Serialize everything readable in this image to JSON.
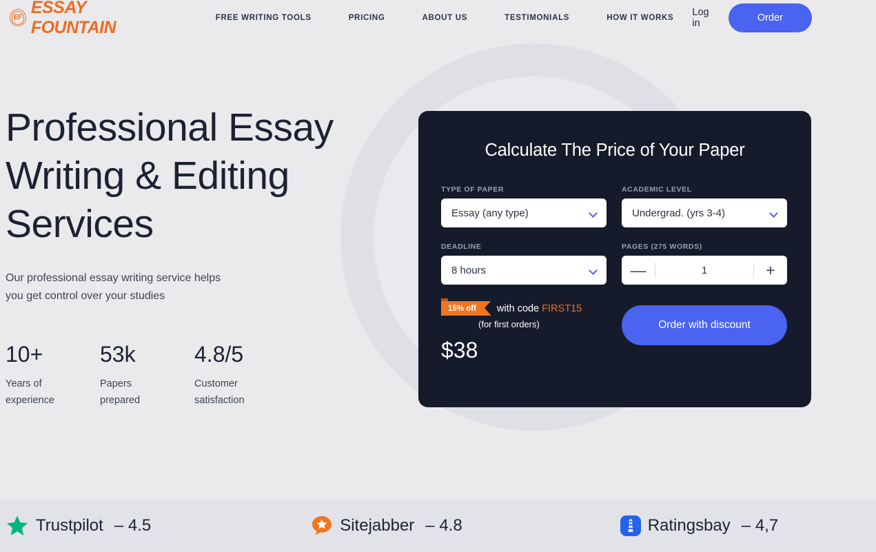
{
  "header": {
    "logo": {
      "badge_text": "EF",
      "brand": "ESSAY FOUNTAIN",
      "badge_icon": "ef-monogram-icon"
    },
    "nav": [
      {
        "label": "FREE WRITING TOOLS"
      },
      {
        "label": "PRICING"
      },
      {
        "label": "ABOUT US"
      },
      {
        "label": "TESTIMONIALS"
      },
      {
        "label": "HOW IT WORKS"
      }
    ],
    "login_label": "Log in",
    "order_label": "Order"
  },
  "hero": {
    "title_line1": "Professional Essay",
    "title_line2": "Writing & Editing",
    "title_line3": "Services",
    "subtitle_line1": "Our professional essay writing service helps",
    "subtitle_line2": "you get control over your studies",
    "stats": [
      {
        "value": "10+",
        "label_line1": "Years of",
        "label_line2": "experience"
      },
      {
        "value": "53k",
        "label_line1": "Papers",
        "label_line2": "prepared"
      },
      {
        "value": "4.8/5",
        "label_line1": "Customer",
        "label_line2": "satisfaction"
      }
    ]
  },
  "calculator": {
    "title": "Calculate The Price of Your Paper",
    "fields": {
      "type_of_paper": {
        "label": "TYPE OF PAPER",
        "value": "Essay (any type)"
      },
      "academic_level": {
        "label": "ACADEMIC LEVEL",
        "value": "Undergrad. (yrs 3-4)"
      },
      "deadline": {
        "label": "DEADLINE",
        "value": "8 hours"
      },
      "pages": {
        "label": "PAGES (275 WORDS)",
        "value": "1",
        "minus": "—",
        "plus": "+"
      }
    },
    "promo": {
      "badge": "15% off",
      "with_code": "with code",
      "code": "FIRST15",
      "note": "(for first orders)",
      "price": "$38"
    },
    "cta_label": "Order with discount",
    "colors": {
      "card_bg": "#161b2b",
      "accent_blue": "#4a63f0",
      "accent_orange": "#ee6c20"
    }
  },
  "reviews": [
    {
      "icon": "trustpilot-star-icon",
      "name": "Trustpilot",
      "dash": "–",
      "score": "4.5",
      "color": "#00b67a"
    },
    {
      "icon": "sitejabber-bubble-star-icon",
      "name": "Sitejabber",
      "dash": "–",
      "score": "4.8",
      "color": "#f07521"
    },
    {
      "icon": "ratingsbay-lighthouse-icon",
      "name": "Ratingsbay",
      "dash": "–",
      "score": "4,7",
      "color": "#2563eb"
    }
  ]
}
